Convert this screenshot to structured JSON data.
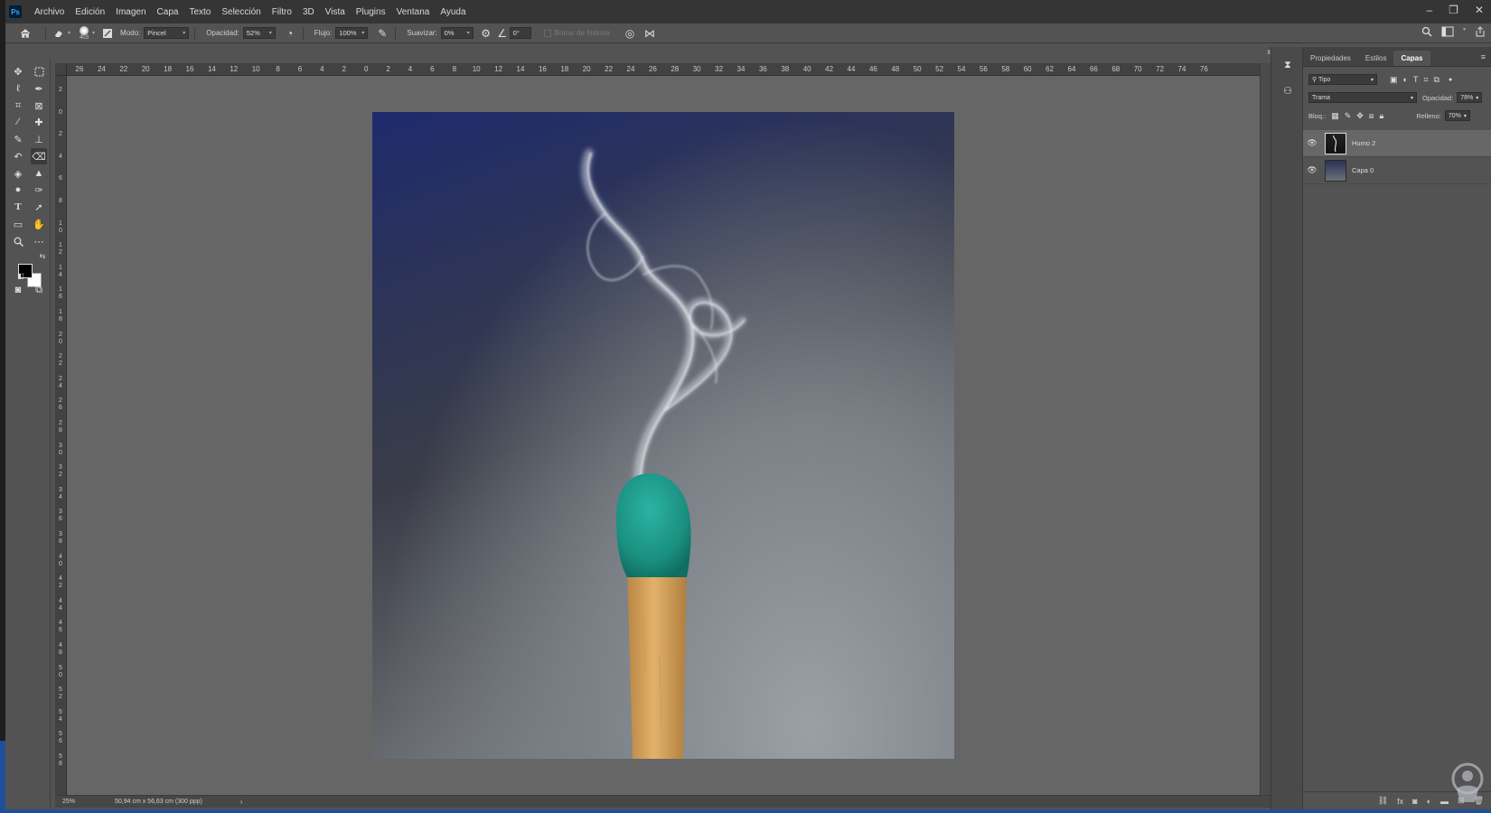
{
  "menubar": {
    "logo": "Ps",
    "items": [
      "Archivo",
      "Edición",
      "Imagen",
      "Capa",
      "Texto",
      "Selección",
      "Filtro",
      "3D",
      "Vista",
      "Plugins",
      "Ventana",
      "Ayuda"
    ],
    "controls": {
      "minimize": "–",
      "restore": "❐",
      "close": "✕"
    }
  },
  "options": {
    "brush_size": "403",
    "mode_label": "Modo:",
    "mode_value": "Pincel",
    "opacity_label": "Opacidad:",
    "opacity_value": "52%",
    "flow_label": "Flujo:",
    "flow_value": "100%",
    "smooth_label": "Suavizar:",
    "smooth_value": "0%",
    "angle_value": "0°",
    "history_label": "Borrar de historia"
  },
  "icons": {
    "home": "home-icon",
    "eraser": "eraser-icon",
    "search": "search-icon",
    "workspace": "workspace-icon",
    "share": "share-icon"
  },
  "ruler": {
    "top": [
      "26",
      "24",
      "22",
      "20",
      "18",
      "16",
      "14",
      "12",
      "10",
      "8",
      "6",
      "4",
      "2",
      "0",
      "2",
      "4",
      "6",
      "8",
      "10",
      "12",
      "14",
      "16",
      "18",
      "20",
      "22",
      "24",
      "26",
      "28",
      "30",
      "32",
      "34",
      "36",
      "38",
      "40",
      "42",
      "44",
      "46",
      "48",
      "50",
      "52",
      "54",
      "56",
      "58",
      "60",
      "62",
      "64",
      "66",
      "68",
      "70",
      "72",
      "74",
      "76"
    ],
    "left": [
      "2",
      "0",
      "2",
      "4",
      "6",
      "8",
      "1 0",
      "1 2",
      "1 4",
      "1 6",
      "1 8",
      "2 0",
      "2 2",
      "2 4",
      "2 6",
      "2 8",
      "3 0",
      "3 2",
      "3 4",
      "3 6",
      "3 8",
      "4 0",
      "4 2",
      "4 4",
      "4 6",
      "4 8",
      "5 0",
      "5 2",
      "5 4",
      "5 6",
      "5 8"
    ]
  },
  "status": {
    "zoom": "25%",
    "dimensions": "50,94 cm x 56,63 cm (300 ppp)",
    "arrow": "›"
  },
  "panel": {
    "tabs": [
      "Propiedades",
      "Estilos",
      "Capas"
    ],
    "active_tab": "Capas",
    "filter_value": "Tipo",
    "blend_mode": "Trama",
    "opacity_label": "Opacidad:",
    "opacity_value": "78%",
    "lock_label": "Bloq.:",
    "fill_label": "Relleno:",
    "fill_value": "70%",
    "layers": [
      {
        "name": "Humo 2",
        "selected": true
      },
      {
        "name": "Capa 0",
        "selected": false
      }
    ]
  },
  "colors": {
    "accent": "#31a8ff",
    "app_bg": "#535353",
    "canvas_bg": "#666666",
    "menubar": "#353535",
    "match_head": "#1f9a8c",
    "match_stick": "#d9a55a",
    "taskbar": "#1f4f9a"
  }
}
